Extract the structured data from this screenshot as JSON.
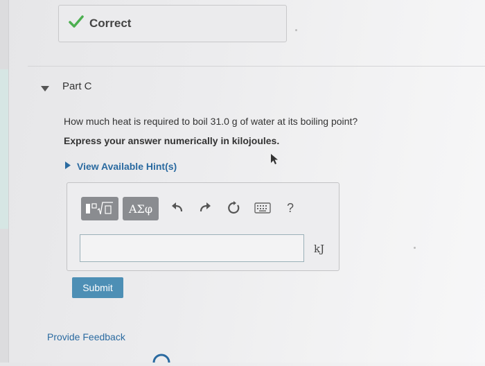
{
  "status": {
    "label": "Correct",
    "icon": "checkmark-icon",
    "color": "#4caf50"
  },
  "part": {
    "title": "Part C"
  },
  "question": {
    "text": "How much heat is required to boil 31.0 g of water at its boiling point?",
    "instruction": "Express your answer numerically in kilojoules."
  },
  "hints": {
    "label": "View Available Hint(s)"
  },
  "toolbar": {
    "symbols_label": "ΑΣφ",
    "help_label": "?"
  },
  "answer": {
    "value": "",
    "placeholder": "",
    "unit": "kJ"
  },
  "submit": {
    "label": "Submit",
    "color": "#4d8fb5"
  },
  "feedback": {
    "label": "Provide Feedback"
  },
  "colors": {
    "link": "#2a6aa0",
    "background": "#ececee"
  }
}
